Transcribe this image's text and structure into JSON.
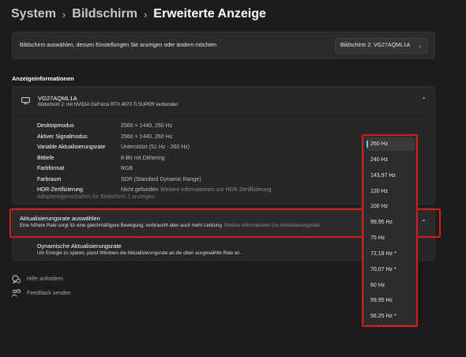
{
  "breadcrumb": {
    "items": [
      "System",
      "Bildschirm"
    ],
    "current": "Erweiterte Anzeige",
    "separator": "›"
  },
  "display_select": {
    "label": "Bildschirm auswählen, dessen Einstellungen Sie anzeigen oder ändern möchten",
    "value": "Bildschirm 2: VG27AQML1A"
  },
  "section_title": "Anzeigeinformationen",
  "monitor": {
    "name": "VG27AQML1A",
    "subtitle": "Bildschirm 2: mit NVIDIA GeForce RTX 4070 Ti SUPER verbunden"
  },
  "info_rows": [
    {
      "key": "Desktopmodus",
      "value": "2560 × 1440, 260 Hz",
      "link": ""
    },
    {
      "key": "Aktiver Signalmodus",
      "value": "2560 × 1440, 260 Hz",
      "link": ""
    },
    {
      "key": "Variable Aktualisierungsrate",
      "value": "Unterstützt (51 Hz - 260 Hz)",
      "link": ""
    },
    {
      "key": "Bittiefe",
      "value": "8-Bit mit Dithering",
      "link": ""
    },
    {
      "key": "Farbformat",
      "value": "RGB",
      "link": ""
    },
    {
      "key": "Farbraum",
      "value": "SDR (Standard Dynamic Range)",
      "link": ""
    },
    {
      "key": "HDR-Zertifizierung",
      "value": "Nicht gefunden",
      "link": "Weitere Informationen zur HDR-Zertifizierung"
    }
  ],
  "adapter_link": "Adaptereigenschaften für Bildschirm 2 anzeigen",
  "refresh": {
    "title": "Aktualisierungsrate auswählen",
    "description": "Eine höhere Rate sorgt für eine gleichmäßigere Bewegung, verbraucht aber auch mehr Leistung",
    "link": "Weitere Informationen zur Aktualisierungsrate"
  },
  "dynamic": {
    "title": "Dynamische Aktualisierungsrate",
    "description": "Um Energie zu sparen, passt Windows die Aktualisierungsrate an die oben ausgewählte Rate an."
  },
  "footer": {
    "help": "Hilfe anfordern",
    "feedback": "Feedback senden"
  },
  "refresh_options": [
    "260 Hz",
    "240 Hz",
    "143,97 Hz",
    "120 Hz",
    "100 Hz",
    "99,95 Hz",
    "75 Hz",
    "72,19 Hz *",
    "70,07 Hz *",
    "60 Hz",
    "59,95 Hz",
    "56,25 Hz *"
  ],
  "selected_option": "260 Hz",
  "colors": {
    "accent": "#60cdff",
    "highlight": "#d41c1c",
    "background": "#1c1c1c"
  },
  "icons": [
    "chevron-right-icon",
    "chevron-down-icon",
    "chevron-up-icon",
    "monitor-icon",
    "help-icon",
    "feedback-icon"
  ]
}
